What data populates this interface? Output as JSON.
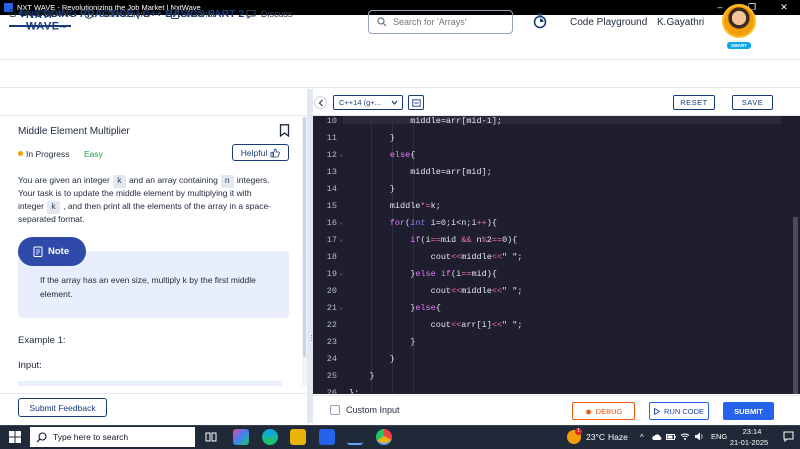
{
  "window": {
    "title": "NXT WAVE - Revolutionizing the Job Market | NxtWave",
    "minimize": "–",
    "maximize": "❐",
    "close": "✕"
  },
  "header": {
    "brand_line1": "NXT",
    "brand_line2": "WAVE",
    "brand_tm": "TM",
    "search_placeholder": "Search for 'Arrays'",
    "code_playground": "Code Playground",
    "username": "K.Gayathri",
    "avatar_badge": "SMART"
  },
  "coursebar": {
    "title": "CODING PRACTICE | C++ BASICS PART 2"
  },
  "tabs": [
    {
      "label": "Description",
      "active": true
    },
    {
      "label": "Submissions",
      "active": false
    },
    {
      "label": "Tutorial",
      "active": false
    },
    {
      "label": "Discuss",
      "active": false
    }
  ],
  "problem": {
    "title": "Middle Element Multiplier",
    "status": "In Progress",
    "difficulty": "Easy",
    "helpful": "Helpful",
    "desc": {
      "p1_a": "You are given an integer",
      "p1_k": "k",
      "p1_b": "and an array containing",
      "p1_n": "n",
      "p1_c": "integers.",
      "p2": "Your task is to update the middle element by multiplying it with",
      "p3_a": "integer",
      "p3_k": "k",
      "p3_b": ", and then print all the elements of the array in a space-",
      "p4": "separated format."
    },
    "note_label": "Note",
    "note_line1": "If the array has an even size, multiply k by the first middle",
    "note_line2": "element.",
    "example_label": "Example 1:",
    "input_label": "Input:",
    "submit_feedback": "Submit Feedback"
  },
  "editor": {
    "language": "C++14 (g+...",
    "reset": "RESET",
    "save": "SAVE",
    "custom_input": "Custom Input",
    "debug": "DEBUG",
    "run_code": "RUN CODE",
    "submit": "SUBMIT",
    "lines": [
      {
        "n": "10",
        "fold": "",
        "html": "            middle=arr[mid-1];"
      },
      {
        "n": "11",
        "fold": "",
        "html": "        }"
      },
      {
        "n": "12",
        "fold": "⌄",
        "html": "        <span class=\"kw\">else</span>{"
      },
      {
        "n": "13",
        "fold": "",
        "html": "            middle=arr[mid];"
      },
      {
        "n": "14",
        "fold": "",
        "html": "        }"
      },
      {
        "n": "15",
        "fold": "",
        "html": "        middle<span class=\"op\">*=</span>k;"
      },
      {
        "n": "16",
        "fold": "⌄",
        "html": "        <span class=\"kw\">for</span>(<span class=\"ty\">int</span> i=0;i&lt;n;i<span class=\"op\">++</span>){"
      },
      {
        "n": "17",
        "fold": "⌄",
        "html": "            <span class=\"kw\">if</span>(i<span class=\"op\">==</span>mid <span class=\"op\">&amp;&amp;</span> n<span class=\"op\">%</span>2<span class=\"op\">==</span>0){"
      },
      {
        "n": "18",
        "fold": "",
        "html": "                cout<span class=\"op\">&lt;&lt;</span>middle<span class=\"op\">&lt;&lt;</span><span class=\"str\">\" \"</span>;"
      },
      {
        "n": "19",
        "fold": "⌄",
        "html": "            }<span class=\"kw\">else if</span>(i<span class=\"op\">==</span>mid){"
      },
      {
        "n": "20",
        "fold": "",
        "html": "                cout<span class=\"op\">&lt;&lt;</span>middle<span class=\"op\">&lt;&lt;</span><span class=\"str\">\" \"</span>;"
      },
      {
        "n": "21",
        "fold": "⌄",
        "html": "            }<span class=\"kw\">else</span>{"
      },
      {
        "n": "22",
        "fold": "",
        "html": "                cout<span class=\"op\">&lt;&lt;</span>arr[i]<span class=\"op\">&lt;&lt;</span><span class=\"str\">\" \"</span>;"
      },
      {
        "n": "23",
        "fold": "",
        "html": "            }"
      },
      {
        "n": "24",
        "fold": "",
        "html": "        }"
      },
      {
        "n": "25",
        "fold": "",
        "html": "    }"
      },
      {
        "n": "26",
        "fold": "",
        "html": "};"
      }
    ]
  },
  "taskbar": {
    "search_placeholder": "Type here to search",
    "weather_badge": "1",
    "temperature": "23°C",
    "weather": "Haze",
    "tray_chevron": "^",
    "lang": "ENG",
    "time": "23:14",
    "date": "21-01-2025"
  }
}
